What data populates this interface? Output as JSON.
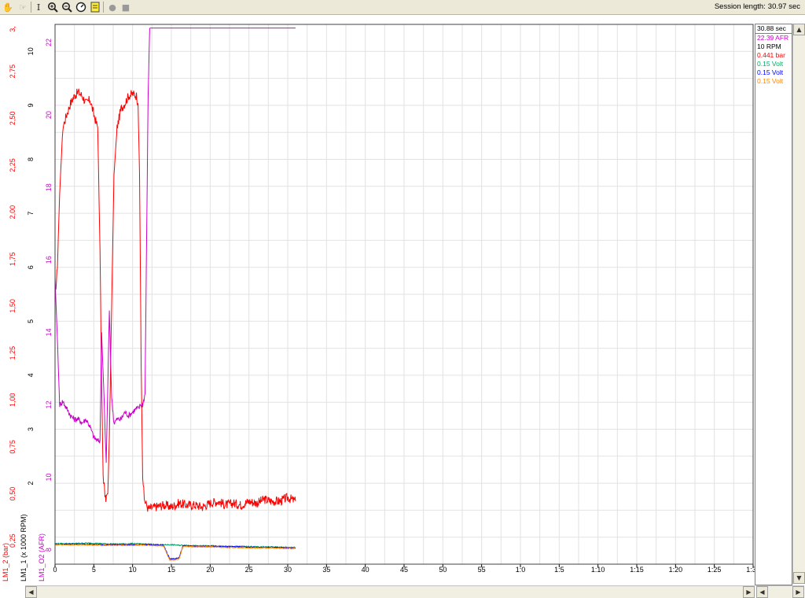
{
  "toolbar": {
    "icons": [
      "hand-icon",
      "select-hand-icon",
      "text-cursor-icon",
      "zoom-in-icon",
      "zoom-out-icon",
      "zoom-reset-icon",
      "notepad-icon",
      "record-icon",
      "stop-icon"
    ],
    "session_label": "Session length:",
    "session_value": "30.97 sec"
  },
  "readout": {
    "time": "30.88 sec",
    "lines": [
      {
        "text": "22.39 AFR",
        "color": "#cc00cc"
      },
      {
        "text": "10 RPM",
        "color": "#000000"
      },
      {
        "text": "0.441 bar",
        "color": "#ff0000"
      },
      {
        "text": "0.15 Volt",
        "color": "#00aa66"
      },
      {
        "text": "0.15 Volt",
        "color": "#0000ff"
      },
      {
        "text": "0.15 Volt",
        "color": "#ff8800"
      }
    ]
  },
  "chart_data": {
    "type": "line",
    "xlim": [
      0,
      90
    ],
    "x_tick_labels": [
      "0",
      "5",
      "10",
      "15",
      "20",
      "25",
      "30",
      "35",
      "40",
      "45",
      "50",
      "55",
      "1:0",
      "1:5",
      "1:10",
      "1:15",
      "1:20",
      "1:25",
      "1:30"
    ],
    "axes": [
      {
        "label": "LM1_2 (bar)",
        "color": "#ff0000",
        "range": [
          0.125,
          3.0
        ],
        "ticks": [
          0.25,
          0.5,
          0.75,
          1.0,
          1.25,
          1.5,
          1.75,
          2.0,
          2.25,
          2.5,
          2.75
        ],
        "tick_labels": [
          "0,25",
          "0,50",
          "0,75",
          "1,00",
          "1,25",
          "1,50",
          "1,75",
          "2,00",
          "2,25",
          "2,50",
          "2,75"
        ],
        "top_label": "3,"
      },
      {
        "label": "LM1_1 (x 1000 RPM)",
        "color": "#000000",
        "range": [
          0.5,
          10.5
        ],
        "ticks": [
          2,
          3,
          4,
          5,
          6,
          7,
          8,
          9,
          10
        ],
        "tick_labels": [
          "2",
          "3",
          "4",
          "5",
          "6",
          "7",
          "8",
          "9",
          "10"
        ]
      },
      {
        "label": "LM1_O2 (AFR)",
        "color": "#cc00cc",
        "range": [
          7.6,
          22.5
        ],
        "ticks": [
          8,
          10,
          12,
          14,
          16,
          18,
          20,
          22
        ],
        "tick_labels": [
          "8",
          "10",
          "12",
          "14",
          "16",
          "18",
          "20",
          "22"
        ]
      }
    ],
    "series": [
      {
        "axis": 0,
        "color": "#ff0000",
        "x": [
          0,
          0.3,
          0.6,
          1,
          1.5,
          2,
          2.5,
          3,
          3.5,
          4,
          4.5,
          5,
          5.5,
          5.8,
          6,
          6.2,
          6.5,
          6.8,
          7,
          7.3,
          7.6,
          8,
          8.5,
          9,
          9.5,
          10,
          10.5,
          10.7,
          10.9,
          11.1,
          11.3,
          11.5,
          12,
          13,
          14,
          15,
          16,
          17,
          18,
          19,
          20,
          21,
          22,
          23,
          24,
          25,
          26,
          27,
          28,
          29,
          30,
          31
        ],
        "y": [
          1.55,
          1.7,
          2.1,
          2.45,
          2.52,
          2.58,
          2.62,
          2.64,
          2.62,
          2.58,
          2.6,
          2.52,
          2.45,
          1.8,
          1.1,
          0.6,
          0.47,
          0.5,
          0.8,
          1.5,
          2.2,
          2.45,
          2.55,
          2.58,
          2.62,
          2.63,
          2.62,
          2.58,
          2.2,
          1.2,
          0.6,
          0.47,
          0.42,
          0.43,
          0.44,
          0.43,
          0.45,
          0.44,
          0.44,
          0.43,
          0.45,
          0.46,
          0.44,
          0.45,
          0.44,
          0.46,
          0.45,
          0.47,
          0.46,
          0.46,
          0.48,
          0.46
        ],
        "noise": 0.025
      },
      {
        "axis": 2,
        "color": "#cc00cc",
        "x": [
          0,
          0.3,
          0.6,
          1,
          1.5,
          2,
          2.5,
          3,
          3.5,
          4,
          4.5,
          5,
          5.5,
          5.8,
          6,
          6.3,
          6.6,
          7,
          7.3,
          7.6,
          8,
          8.5,
          9,
          9.5,
          10,
          10.5,
          10.8,
          11,
          11.3,
          11.6,
          12,
          12.2,
          12.5,
          31
        ],
        "y": [
          15.5,
          13.8,
          12.0,
          12.1,
          11.9,
          11.7,
          11.6,
          11.6,
          11.5,
          11.6,
          11.4,
          11.1,
          11.0,
          11.0,
          14.0,
          12.3,
          10.4,
          14.6,
          12.2,
          11.5,
          11.6,
          11.6,
          11.8,
          11.7,
          11.8,
          11.9,
          11.9,
          12.0,
          12.0,
          12.3,
          20.5,
          22.4,
          22.4,
          22.4
        ],
        "noise": 0.08
      },
      {
        "axis": 1,
        "color": "#009966",
        "x": [
          0,
          2,
          4,
          6,
          8,
          10,
          12,
          14,
          15,
          16,
          17,
          18,
          20,
          22,
          24,
          26,
          28,
          30,
          31
        ],
        "y": [
          0.88,
          0.88,
          0.89,
          0.88,
          0.87,
          0.88,
          0.87,
          0.86,
          0.86,
          0.85,
          0.85,
          0.84,
          0.84,
          0.83,
          0.83,
          0.82,
          0.82,
          0.81,
          0.81
        ],
        "noise": 0.01
      },
      {
        "axis": 1,
        "color": "#0000ff",
        "x": [
          0,
          2,
          4,
          6,
          8,
          10,
          12,
          14,
          14.4,
          14.8,
          15.5,
          16,
          16.5,
          17,
          18,
          20,
          22,
          24,
          26,
          28,
          30,
          31
        ],
        "y": [
          0.87,
          0.87,
          0.87,
          0.86,
          0.86,
          0.86,
          0.86,
          0.85,
          0.72,
          0.6,
          0.6,
          0.62,
          0.84,
          0.84,
          0.83,
          0.83,
          0.82,
          0.82,
          0.81,
          0.81,
          0.8,
          0.8
        ],
        "noise": 0.01
      },
      {
        "axis": 1,
        "color": "#ff8800",
        "x": [
          0,
          2,
          4,
          6,
          8,
          10,
          12,
          14,
          14.4,
          14.8,
          15.5,
          16,
          16.5,
          17,
          18,
          20,
          22,
          24,
          26,
          28,
          30,
          31
        ],
        "y": [
          0.86,
          0.86,
          0.86,
          0.85,
          0.85,
          0.85,
          0.85,
          0.84,
          0.7,
          0.58,
          0.58,
          0.6,
          0.83,
          0.83,
          0.82,
          0.82,
          0.81,
          0.81,
          0.8,
          0.8,
          0.79,
          0.79
        ],
        "noise": 0.01
      }
    ]
  }
}
